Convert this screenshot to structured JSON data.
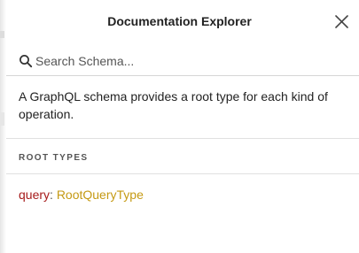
{
  "header": {
    "title": "Documentation Explorer",
    "close_icon": "close-icon"
  },
  "search": {
    "placeholder": "Search Schema...",
    "value": "",
    "icon": "search-icon"
  },
  "description": "A GraphQL schema provides a root type for each kind of operation.",
  "root_types": {
    "title": "ROOT TYPES",
    "fields": [
      {
        "name": "query",
        "separator": ": ",
        "type": "RootQueryType"
      }
    ]
  },
  "colors": {
    "field_name": "#a61b1b",
    "type_link": "#c59a14",
    "text": "#222222",
    "divider": "#e0e0e0"
  }
}
